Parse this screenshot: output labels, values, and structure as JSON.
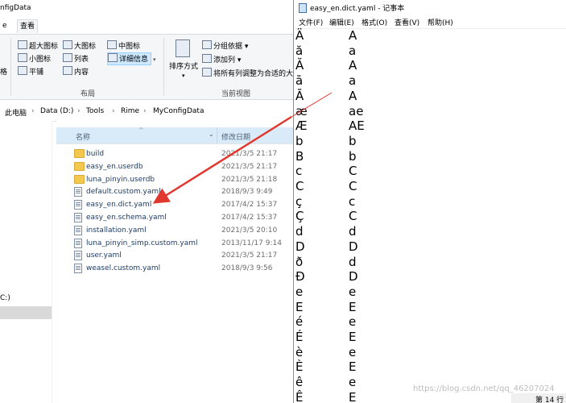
{
  "explorer": {
    "title_partial": "nfigData",
    "tabs": [
      "e",
      "查看"
    ],
    "ribbon": {
      "layout_items": [
        {
          "label": "超大图标",
          "selected": false
        },
        {
          "label": "大图标",
          "selected": false
        },
        {
          "label": "中图标",
          "selected": false
        },
        {
          "label": "小图标",
          "selected": false
        },
        {
          "label": "列表",
          "selected": false
        },
        {
          "label": "详细信息",
          "selected": true
        },
        {
          "label": "平铺",
          "selected": false
        },
        {
          "label": "内容",
          "selected": false
        }
      ],
      "left_partial_label": "格",
      "sort_label": "排序方式",
      "group_by_label": "分组依据",
      "add_column_label": "添加列",
      "fit_columns_label": "将所有列调整为合适的大",
      "group_layout": "布局",
      "group_current_view": "当前视图"
    },
    "breadcrumb": [
      "此电脑",
      "Data (D:)",
      "Tools",
      "Rime",
      "MyConfigData"
    ],
    "columns": {
      "name": "名称",
      "date": "修改日期"
    },
    "nav_drive_partial": "C:)",
    "files": [
      {
        "name": "build",
        "date": "2021/3/5 21:17",
        "type": "folder"
      },
      {
        "name": "easy_en.userdb",
        "date": "2021/3/5 21:17",
        "type": "folder"
      },
      {
        "name": "luna_pinyin.userdb",
        "date": "2021/3/5 21:18",
        "type": "folder"
      },
      {
        "name": "default.custom.yaml",
        "date": "2018/9/3 9:49",
        "type": "file"
      },
      {
        "name": "easy_en.dict.yaml",
        "date": "2017/4/2 15:37",
        "type": "file"
      },
      {
        "name": "easy_en.schema.yaml",
        "date": "2017/4/2 15:37",
        "type": "file"
      },
      {
        "name": "installation.yaml",
        "date": "2021/3/5 20:10",
        "type": "file"
      },
      {
        "name": "luna_pinyin_simp.custom.yaml",
        "date": "2013/11/17 9:14",
        "type": "file"
      },
      {
        "name": "user.yaml",
        "date": "2021/3/5 21:17",
        "type": "file"
      },
      {
        "name": "weasel.custom.yaml",
        "date": "2018/9/3 9:56",
        "type": "file"
      }
    ]
  },
  "notepad": {
    "title": "easy_en.dict.yaml - 记事本",
    "menu": [
      "文件(F)",
      "编辑(E)",
      "格式(O)",
      "查看(V)",
      "帮助(H)"
    ],
    "lines": [
      [
        "Ä",
        "A"
      ],
      [
        "ă",
        "a"
      ],
      [
        "Ă",
        "A"
      ],
      [
        "ā",
        "a"
      ],
      [
        "Ā",
        "A"
      ],
      [
        "æ",
        "ae"
      ],
      [
        "Æ",
        "AE"
      ],
      [
        "b",
        "b"
      ],
      [
        "B",
        "b"
      ],
      [
        "c",
        "C"
      ],
      [
        "C",
        "C"
      ],
      [
        "ç",
        "c"
      ],
      [
        "Ç",
        "C"
      ],
      [
        "d",
        "d"
      ],
      [
        "D",
        "D"
      ],
      [
        "ð",
        "d"
      ],
      [
        "Đ",
        "D"
      ],
      [
        "e",
        "e"
      ],
      [
        "E",
        "E"
      ],
      [
        "é",
        "e"
      ],
      [
        "É",
        "E"
      ],
      [
        "è",
        "e"
      ],
      [
        "È",
        "E"
      ],
      [
        "ê",
        "e"
      ],
      [
        "Ê",
        "E"
      ]
    ],
    "status": "第 14 行",
    "watermark": "https://blog.csdn.net/qq_46207024"
  },
  "annotation_color": "#e0382f"
}
